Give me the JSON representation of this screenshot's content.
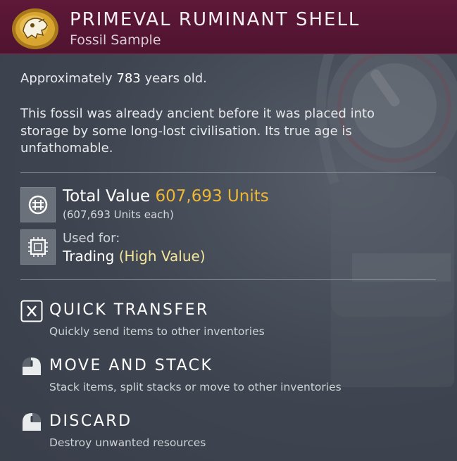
{
  "item": {
    "name": "PRIMEVAL RUMINANT SHELL",
    "category": "Fossil Sample",
    "icon": "fossil-skull-icon"
  },
  "age": {
    "prefix": "Approximately",
    "years": "783",
    "suffix": "years old."
  },
  "description": "This fossil was already ancient before it was placed into storage by some long-lost civilisation. Its true age is unfathomable.",
  "value": {
    "label": "Total Value",
    "amount": "607,693 Units",
    "each": "(607,693 Units each)",
    "icon": "units-currency-icon"
  },
  "usage": {
    "label": "Used for:",
    "purpose": "Trading",
    "qualifier": "(High Value)",
    "icon": "trade-chip-icon"
  },
  "actions": [
    {
      "title": "QUICK TRANSFER",
      "description": "Quickly send items to other inventories",
      "icon": "x-key-icon"
    },
    {
      "title": "MOVE AND STACK",
      "description": "Stack items, split stacks or move to other inventories",
      "icon": "mouse-left-click-icon"
    },
    {
      "title": "DISCARD",
      "description": "Destroy unwanted resources",
      "icon": "mouse-right-click-icon"
    }
  ],
  "colors": {
    "header": "#5e1838",
    "value_accent": "#f0b732",
    "high_value_accent": "#f3e59b"
  }
}
